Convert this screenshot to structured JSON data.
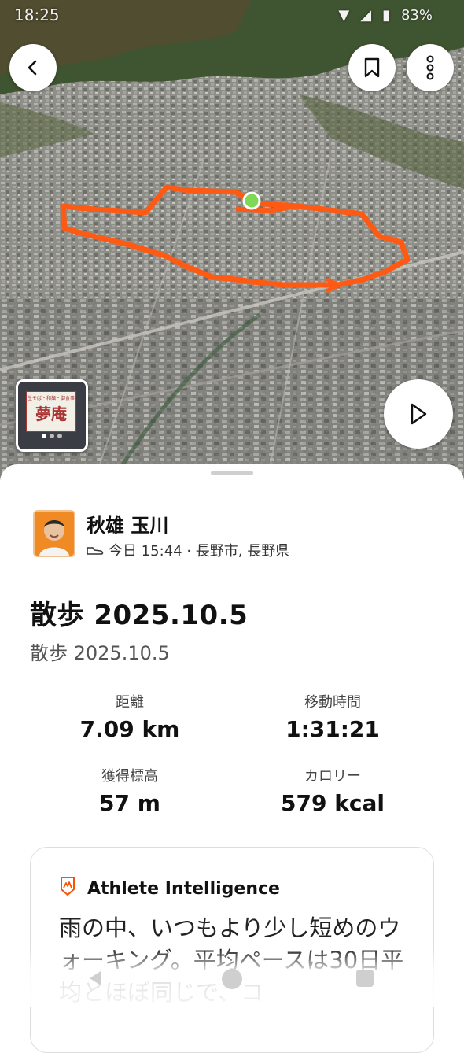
{
  "status_bar": {
    "time": "18:25",
    "battery": "83%"
  },
  "map": {
    "route_color": "#ff5a14",
    "start_marker_color": "#7ed957",
    "icons": [
      "back-arrow-icon",
      "bookmark-icon",
      "more-vertical-icon",
      "play-icon"
    ]
  },
  "photo_thumb": {
    "sign_text_top": "生そば・和麺・御食事",
    "sign_text_main": "夢庵"
  },
  "athlete": {
    "name": "秋雄 玉川",
    "activity_icon": "shoe-icon",
    "meta": "今日 15:44 · 長野市, 長野県"
  },
  "activity": {
    "title": "散歩 2025.10.5",
    "subtitle": "散歩 2025.10.5"
  },
  "stats": {
    "distance_label": "距離",
    "distance_value": "7.09 km",
    "moving_time_label": "移動時間",
    "moving_time_value": "1:31:21",
    "elevation_label": "獲得標高",
    "elevation_value": "57 m",
    "calories_label": "カロリー",
    "calories_value": "579 kcal"
  },
  "athlete_intelligence": {
    "title": "Athlete Intelligence",
    "text": "雨の中、いつもより少し短めのウォーキング。平均ペースは30日平均とほぼ同じで、コ",
    "accent": "#fc5200"
  }
}
